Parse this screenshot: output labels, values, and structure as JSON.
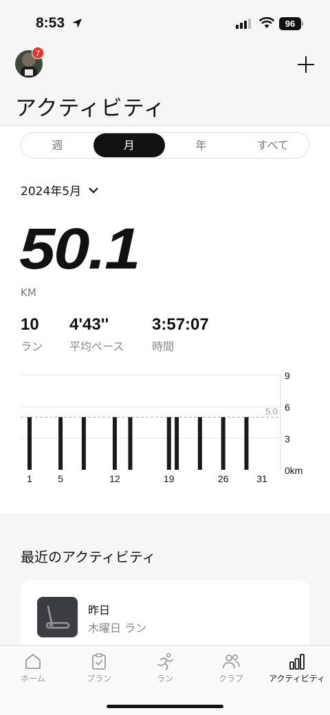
{
  "status_bar": {
    "time": "8:53",
    "battery": "96"
  },
  "header": {
    "badge_count": "7",
    "title": "アクティビティ"
  },
  "segments": [
    {
      "label": "週",
      "active": false
    },
    {
      "label": "月",
      "active": true
    },
    {
      "label": "年",
      "active": false
    },
    {
      "label": "すべて",
      "active": false
    }
  ],
  "period": "2024年5月",
  "summary": {
    "distance": "50.1",
    "unit": "KM",
    "stats": [
      {
        "value": "10",
        "label": "ラン"
      },
      {
        "value": "4'43''",
        "label": "平均ペース"
      },
      {
        "value": "3:57:07",
        "label": "時間"
      }
    ]
  },
  "chart_data": {
    "type": "bar",
    "x": [
      1,
      5,
      8,
      12,
      14,
      19,
      20,
      23,
      26,
      29
    ],
    "values": [
      5.0,
      5.0,
      5.0,
      5.0,
      5.0,
      5.0,
      5.0,
      5.0,
      5.0,
      5.0
    ],
    "x_tick_labels": [
      "1",
      "5",
      "12",
      "19",
      "26",
      "31"
    ],
    "x_tick_values": [
      1,
      5,
      12,
      19,
      26,
      31
    ],
    "y_tick_labels": [
      "9",
      "6",
      "3",
      "0km"
    ],
    "y_tick_values": [
      9,
      6,
      3,
      0
    ],
    "ylim": [
      0,
      9
    ],
    "xlim": [
      1,
      31
    ],
    "average_line": {
      "value": 5.0,
      "label": "5.0"
    },
    "grid": true,
    "bar_color": "#1a1a1a"
  },
  "recent": {
    "title": "最近のアクティビティ",
    "card": {
      "title": "昨日",
      "subtitle": "木曜日 ラン"
    }
  },
  "tabbar": [
    {
      "label": "ホーム",
      "icon": "home-icon",
      "active": false
    },
    {
      "label": "プラン",
      "icon": "clipboard-icon",
      "active": false
    },
    {
      "label": "ラン",
      "icon": "runner-icon",
      "active": false
    },
    {
      "label": "クラブ",
      "icon": "people-icon",
      "active": false
    },
    {
      "label": "アクティビティ",
      "icon": "bar-chart-icon",
      "active": true
    }
  ]
}
